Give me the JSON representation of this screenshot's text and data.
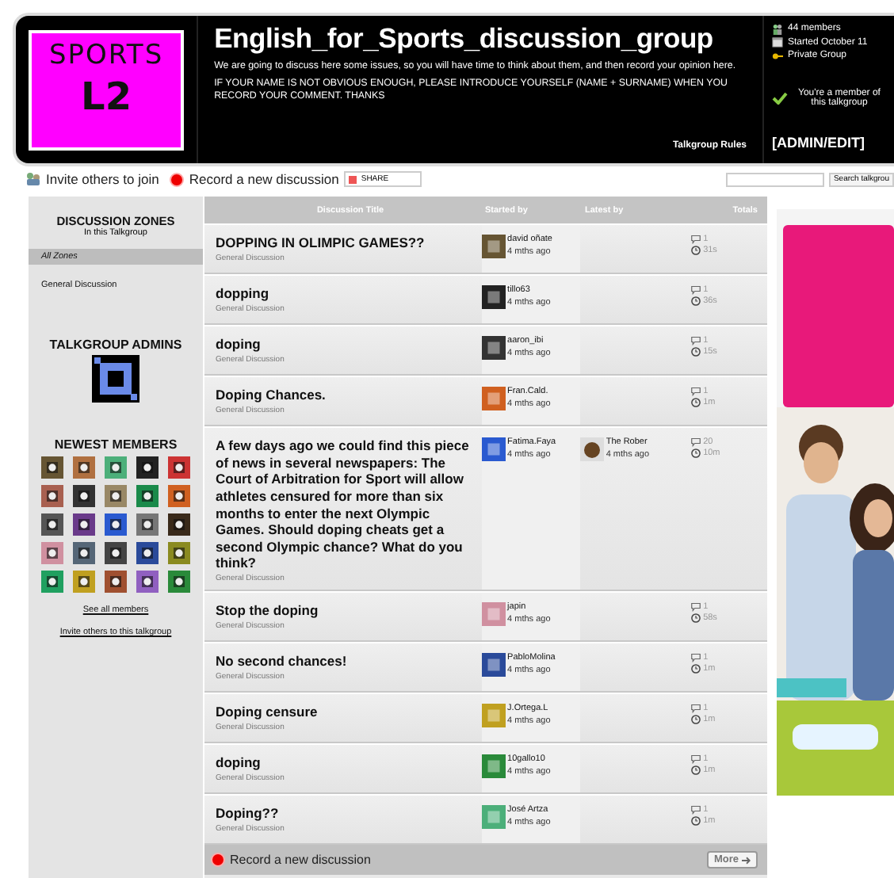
{
  "header": {
    "logo_lines": [
      "SPORTS",
      "L2"
    ],
    "title": "English_for_Sports_discussion_group",
    "description": [
      "We are going to discuss here some issues, so you will have time to think about them, and then record your opinion here.",
      "IF YOUR NAME IS NOT OBVIOUS ENOUGH, PLEASE INTRODUCE YOURSELF (NAME + SURNAME) WHEN YOU RECORD YOUR COMMENT. THANKS"
    ],
    "rules_link": "Talkgroup Rules",
    "stats": [
      "44 members",
      "Started October 11",
      "Private Group"
    ],
    "membership": "You're a member of this talkgroup",
    "admin_link": "[ADMIN/EDIT]"
  },
  "toolbar": {
    "invite": "Invite others to join",
    "record": "Record a new discussion",
    "share": "SHARE",
    "search_button": "Search talkgrou"
  },
  "sidebar": {
    "zones_title": "DISCUSSION ZONES",
    "zones_subtitle": "In this Talkgroup",
    "zones": [
      {
        "label": "All Zones",
        "selected": true
      },
      {
        "label": "General Discussion",
        "selected": false
      }
    ],
    "admins_title": "TALKGROUP ADMINS",
    "members_title": "NEWEST MEMBERS",
    "see_all": "See all members",
    "invite_link": "Invite others to this talkgroup"
  },
  "table": {
    "columns": [
      "Discussion Title",
      "Started by",
      "Latest by",
      "Totals"
    ],
    "rows": [
      {
        "title": "DOPPING IN OLIMPIC GAMES??",
        "zone": "General Discussion",
        "started_by": "david oñate",
        "started_ago": "4 mths ago",
        "replies": "1",
        "time": "31s"
      },
      {
        "title": "dopping",
        "zone": "General Discussion",
        "started_by": "tillo63",
        "started_ago": "4 mths ago",
        "replies": "1",
        "time": "36s"
      },
      {
        "title": "doping",
        "zone": "General Discussion",
        "started_by": "aaron_ibi",
        "started_ago": "4 mths ago",
        "replies": "1",
        "time": "15s"
      },
      {
        "title": "Doping Chances.",
        "zone": "General Discussion",
        "started_by": "Fran.Cald.",
        "started_ago": "4 mths ago",
        "replies": "1",
        "time": "1m"
      },
      {
        "title": "A few days ago we could find this piece of news in several newspapers: The Court of Arbitration for Sport will allow athletes censured for more than six months to enter the next Olympic Games. Should doping cheats get a second Olympic chance? What do you think?",
        "zone": "General Discussion",
        "started_by": "Fatima.Faya",
        "started_ago": "4 mths ago",
        "latest_by": "The Rober",
        "latest_ago": "4 mths ago",
        "replies": "20",
        "time": "10m"
      },
      {
        "title": "Stop the doping",
        "zone": "General Discussion",
        "started_by": "japin",
        "started_ago": "4 mths ago",
        "replies": "1",
        "time": "58s"
      },
      {
        "title": "No second chances!",
        "zone": "General Discussion",
        "started_by": "PabloMolina",
        "started_ago": "4 mths ago",
        "replies": "1",
        "time": "1m"
      },
      {
        "title": "Doping censure",
        "zone": "General Discussion",
        "started_by": "J.Ortega.L",
        "started_ago": "4 mths ago",
        "replies": "1",
        "time": "1m"
      },
      {
        "title": "doping",
        "zone": "General Discussion",
        "started_by": "10gallo10",
        "started_ago": "4 mths ago",
        "replies": "1",
        "time": "1m"
      },
      {
        "title": "Doping??",
        "zone": "General Discussion",
        "started_by": "José Artza",
        "started_ago": "4 mths ago",
        "replies": "1",
        "time": "1m"
      }
    ],
    "footer_record": "Record a new discussion",
    "more_button": "More"
  }
}
